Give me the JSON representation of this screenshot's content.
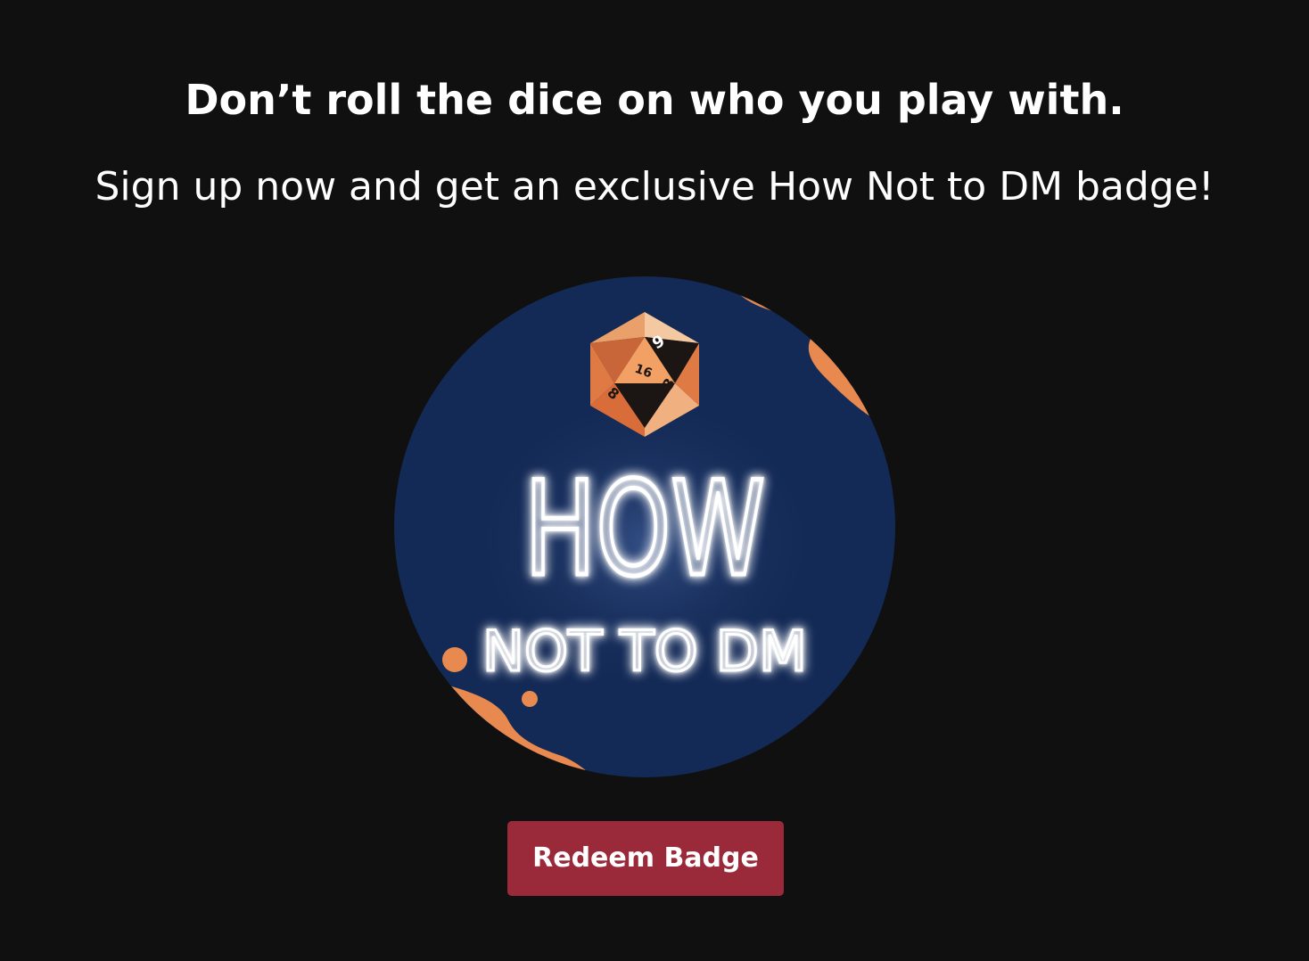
{
  "promo": {
    "headline": "Don’t roll the dice on who you play with.",
    "subheadline": "Sign up now and get an exclusive How Not to DM badge!"
  },
  "badge": {
    "icon": "d20-dice-icon",
    "logo_line1": "HOW",
    "logo_line2": "NOT TO DM",
    "die_faces": [
      "9",
      "16",
      "8",
      "3"
    ],
    "colors": {
      "circle": "#142a56",
      "accent": "#e8894f",
      "neon": "#ffffff"
    }
  },
  "actions": {
    "redeem_label": "Redeem Badge",
    "redeem_color": "#9a2a3a"
  }
}
